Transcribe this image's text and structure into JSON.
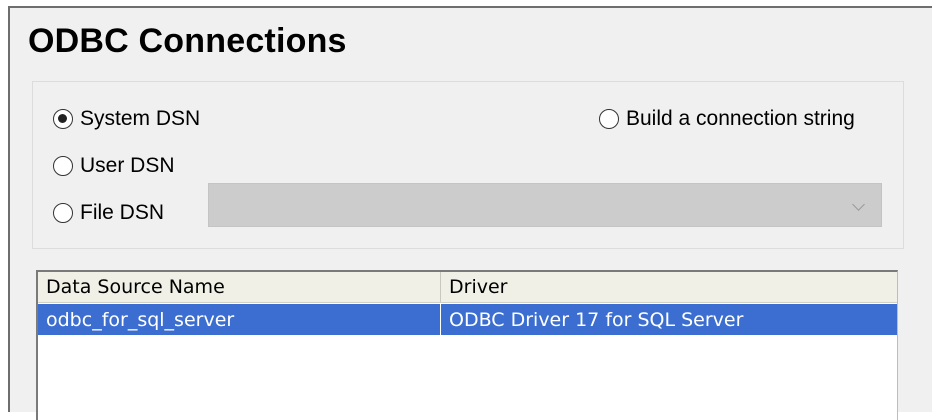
{
  "dialog": {
    "title": "ODBC Connections"
  },
  "dsn_options": {
    "system_dsn": {
      "label": "System DSN",
      "checked": true
    },
    "user_dsn": {
      "label": "User DSN",
      "checked": false
    },
    "file_dsn": {
      "label": "File DSN",
      "checked": false
    },
    "build_connection_string": {
      "label": "Build a connection string",
      "checked": false
    },
    "file_dsn_dropdown": {
      "value": "",
      "enabled": false
    }
  },
  "data_sources": {
    "columns": [
      "Data Source Name",
      "Driver"
    ],
    "rows": [
      {
        "name": "odbc_for_sql_server",
        "driver": "ODBC Driver 17 for SQL Server",
        "selected": true
      }
    ]
  },
  "colors": {
    "selection": "#3b6ed0",
    "dialog_background": "#f0f0f0",
    "disabled_dropdown": "#cccccc"
  }
}
